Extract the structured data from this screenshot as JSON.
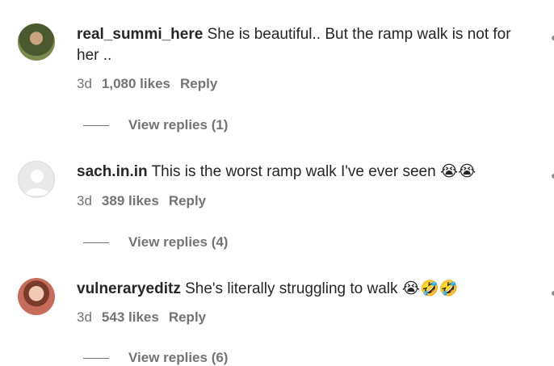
{
  "comments": [
    {
      "username": "real_summi_here",
      "text": "She is beautiful.. But the ramp walk is not for her ..",
      "age": "3d",
      "likes": "1,080 likes",
      "reply_label": "Reply",
      "view_replies": "View replies (1)"
    },
    {
      "username": "sach.in.in",
      "text": "This is the worst ramp walk I've ever seen 😭😭",
      "age": "3d",
      "likes": "389 likes",
      "reply_label": "Reply",
      "view_replies": "View replies (4)"
    },
    {
      "username": "vulneraryeditz",
      "text": "She's literally struggling to walk 😭🤣🤣",
      "age": "3d",
      "likes": "543 likes",
      "reply_label": "Reply",
      "view_replies": "View replies (6)"
    }
  ],
  "icons": {
    "avatar_default": "default-avatar-icon",
    "more": "more-options-icon"
  },
  "colors": {
    "text": "#262626",
    "secondary": "#737373"
  }
}
